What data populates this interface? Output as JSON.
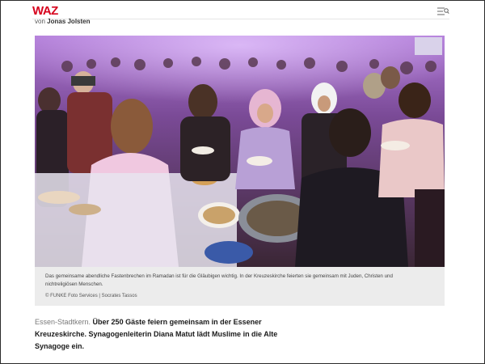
{
  "header": {
    "logo": "WAZ",
    "menu_icon": "search-menu-icon"
  },
  "byline": {
    "prefix": "von",
    "author": "Jonas Jolsten"
  },
  "photo": {
    "icon": "photo-image"
  },
  "caption": {
    "text": "Das gemeinsame abendliche Fastenbrechen im Ramadan ist für die Gläubigen wichtig. In der Kreuzeskirche feierten sie gemeinsam mit Juden, Christen und nichtreligiösen Menschen.",
    "credit": "© FUNKE Foto Services | Socrates Tassos"
  },
  "lead": {
    "place": "Essen-Stadtkern.",
    "text": " Über 250 Gäste feiern gemeinsam in der Essener Kreuzeskirche. Synagogenleiterin Diana Matut lädt Muslime in die Alte Synagoge ein."
  }
}
